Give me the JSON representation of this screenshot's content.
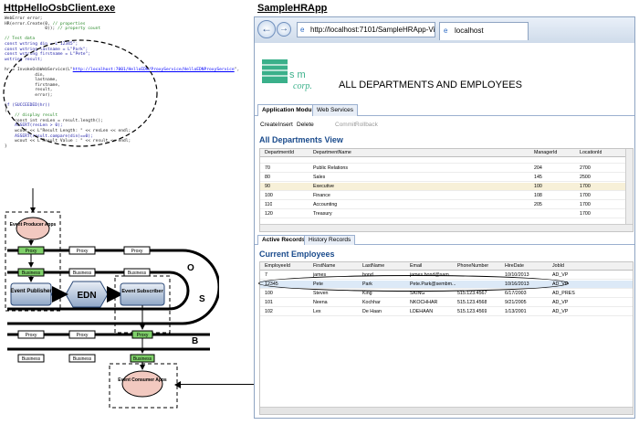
{
  "left_title": "HttpHelloOsbClient.exe",
  "right_title": "SampleHRApp",
  "code_lines": [
    [
      "kw",
      "WebError error;"
    ],
    [
      "",
      "HR(error.Create(0, "
    ],
    [
      "cm",
      "// properties"
    ],
    [
      "",
      "                0)); "
    ],
    [
      "cm",
      "// property count"
    ]
  ],
  "code": {
    "l1": "WebError error;",
    "l2a": "HR(error.Create(0, ",
    "l2b": "// properties",
    "l3a": "                0)); ",
    "l3b": "// property count",
    "l4": "// Test data",
    "l5": "const wstring din = L\"12345\";",
    "l6": "const wstring lastname = L\"Park\";",
    "l7": "const wstring firstname = L\"Pete\";",
    "l8": "wstring result;",
    "l9a": "hr = InvokeOsbWebService(L\"",
    "l9b": "http://localhost:7001/HelloEDN/ProxyService/HelloEDNProxyService",
    "l9c": "\",",
    "l10": "            din,",
    "l11": "            lastname,",
    "l12": "            firstname,",
    "l13": "            result,",
    "l14": "            error);",
    "l15": "if (SUCCEEDED(hr))",
    "l16": "{",
    "l17": "    // display result",
    "l18": "    const int resLen = result.length();",
    "l19": "    ASSERT(resLen > 0);",
    "l20": "    wcout << L\"Result Length: \" << resLen << endl;",
    "l21": "    ASSERT(result.compare(din)==0);",
    "l22": "    wcout << L\"Result Value : \" << result << endl;",
    "l23": "}"
  },
  "diagram": {
    "producer": "Event Producer Apps",
    "proxy": "Proxy",
    "business": "Business",
    "publisher": "Event Publisher",
    "edn": "EDN",
    "subscriber": "Event Subscriber",
    "consumer": "Event Consumer Apps",
    "o": "O",
    "s": "S",
    "b": "B"
  },
  "browser": {
    "url": "http://localhost:7101/SampleHRApp-ViewController-...",
    "tab_title": "localhost",
    "logo_text1": "s m",
    "logo_text2": "corp.",
    "heading": "ALL DEPARTMENTS AND EMPLOYEES",
    "top_tabs": [
      "Application Module",
      "Web Services"
    ],
    "toolbar": [
      "CreateInsert",
      "Delete",
      "Commit",
      "Rollback"
    ],
    "dept_title": "All Departments View",
    "dept_cols": [
      "DepartmentId",
      "DepartmentName",
      "ManagerId",
      "LocationId"
    ],
    "dept_rows": [
      [
        "70",
        "Public Relations",
        "204",
        "2700"
      ],
      [
        "80",
        "Sales",
        "145",
        "2500"
      ],
      [
        "90",
        "Executive",
        "100",
        "1700"
      ],
      [
        "100",
        "Finance",
        "108",
        "1700"
      ],
      [
        "110",
        "Accounting",
        "205",
        "1700"
      ],
      [
        "120",
        "Treasury",
        "",
        "1700"
      ]
    ],
    "rec_tabs": [
      "Active Records",
      "History Records"
    ],
    "emp_title": "Current Employees",
    "emp_cols": [
      "EmployeeId",
      "FirstName",
      "LastName",
      "Email",
      "PhoneNumber",
      "HireDate",
      "JobId"
    ],
    "emp_rows": [
      [
        "7",
        "james",
        "bond",
        "james.bond@sam...",
        "",
        "10/10/2013",
        "AD_VP"
      ],
      [
        "12345",
        "Pete",
        "Park",
        "Pete.Park@sembm...",
        "",
        "10/16/2013",
        "AD_VP"
      ],
      [
        "100",
        "Steven",
        "King",
        "SKING",
        "515.123.4567",
        "6/17/2003",
        "AD_PRES"
      ],
      [
        "101",
        "Neena",
        "Kochhar",
        "NKOCHHAR",
        "515.123.4568",
        "9/21/2005",
        "AD_VP"
      ],
      [
        "102",
        "Lex",
        "De Haan",
        "LDEHAAN",
        "515.123.4569",
        "1/13/2001",
        "AD_VP"
      ]
    ]
  }
}
